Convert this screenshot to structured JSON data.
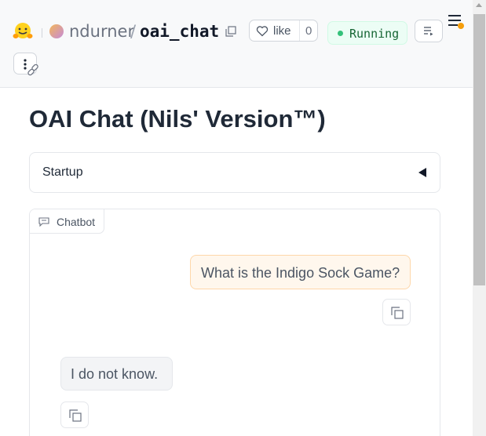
{
  "header": {
    "owner": "ndurner",
    "slash": "/",
    "space": "oai_chat",
    "like_label": "like",
    "like_count": "0",
    "status": "Running",
    "icons": [
      "huggingface-logo-icon",
      "copy-icon",
      "heart-icon",
      "logs-icon",
      "menu-icon",
      "more-vertical-icon",
      "link-icon"
    ]
  },
  "page": {
    "title": "OAI Chat (Nils' Version™)"
  },
  "accordion": {
    "label": "Startup",
    "caret_icon": "caret-left-icon"
  },
  "chatbot": {
    "label": "Chatbot",
    "messages": [
      {
        "role": "user",
        "text": "What is the Indigo Sock Game?"
      },
      {
        "role": "bot",
        "text": "I do not know."
      }
    ]
  },
  "colors": {
    "running_green": "#34c17a",
    "user_bubble": "#fff7ed",
    "user_bubble_border": "#fed7aa",
    "bot_bubble": "#f3f4f6",
    "menu_badge": "#f59e0b"
  }
}
